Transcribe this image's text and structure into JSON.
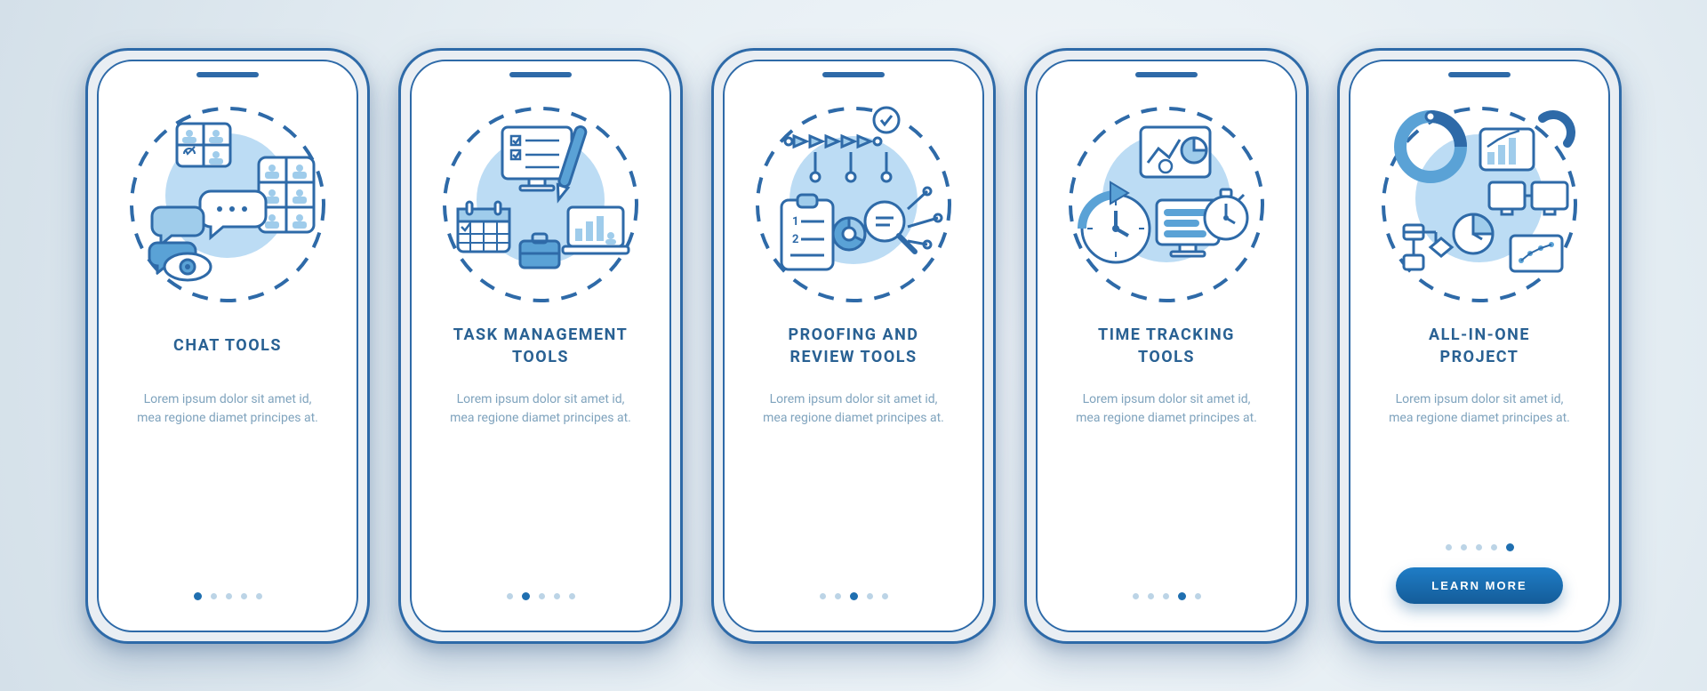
{
  "colors": {
    "primary": "#1f6fb0",
    "primary_dark": "#145c99",
    "text_title": "#296193",
    "text_body": "#7fa3bd",
    "dot_inactive": "#bcd4e6",
    "frame": "#2e6aa8"
  },
  "body_text": "Lorem ipsum dolor sit amet id, mea regione diamet principes at.",
  "cta_label": "LEARN MORE",
  "screens": [
    {
      "id": "chat-tools",
      "title": "CHAT TOOLS",
      "icon": "chat-tools-icon",
      "active_index": 0,
      "has_cta": false
    },
    {
      "id": "task-management-tools",
      "title": "TASK MANAGEMENT\nTOOLS",
      "icon": "task-management-icon",
      "active_index": 1,
      "has_cta": false
    },
    {
      "id": "proofing-review-tools",
      "title": "PROOFING AND\nREVIEW TOOLS",
      "icon": "proofing-review-icon",
      "active_index": 2,
      "has_cta": false
    },
    {
      "id": "time-tracking-tools",
      "title": "TIME TRACKING\nTOOLS",
      "icon": "time-tracking-icon",
      "active_index": 3,
      "has_cta": false
    },
    {
      "id": "all-in-one-project",
      "title": "ALL-IN-ONE\nPROJECT",
      "icon": "all-in-one-icon",
      "active_index": 4,
      "has_cta": true
    }
  ],
  "total_dots": 5
}
